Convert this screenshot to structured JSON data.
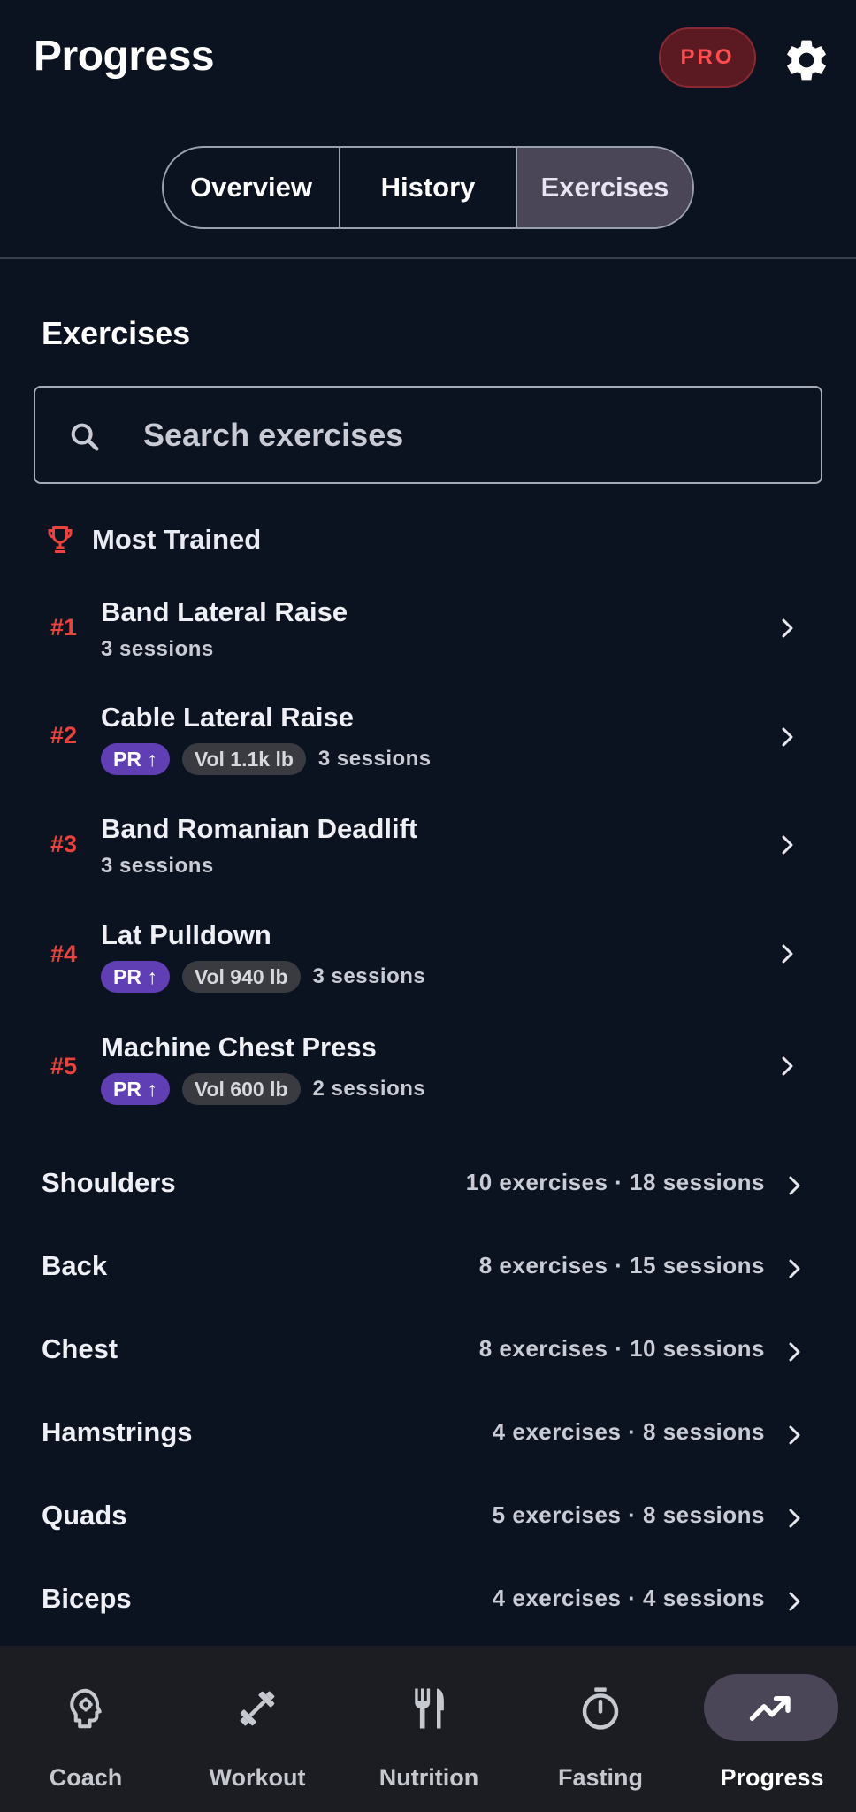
{
  "header": {
    "title": "Progress",
    "pro_label": "PRO"
  },
  "tabs": [
    {
      "label": "Overview",
      "active": false
    },
    {
      "label": "History",
      "active": false
    },
    {
      "label": "Exercises",
      "active": true
    }
  ],
  "section": {
    "title": "Exercises"
  },
  "search": {
    "placeholder": "Search exercises"
  },
  "most_trained": {
    "label": "Most Trained",
    "items": [
      {
        "rank": "#1",
        "name": "Band Lateral Raise",
        "pr": "",
        "vol": "",
        "sessions": "3 sessions"
      },
      {
        "rank": "#2",
        "name": "Cable Lateral Raise",
        "pr": "PR ↑",
        "vol": "Vol 1.1k lb",
        "sessions": "3 sessions"
      },
      {
        "rank": "#3",
        "name": "Band Romanian Deadlift",
        "pr": "",
        "vol": "",
        "sessions": "3 sessions"
      },
      {
        "rank": "#4",
        "name": "Lat Pulldown",
        "pr": "PR ↑",
        "vol": "Vol 940 lb",
        "sessions": "3 sessions"
      },
      {
        "rank": "#5",
        "name": "Machine Chest Press",
        "pr": "PR ↑",
        "vol": "Vol 600 lb",
        "sessions": "2 sessions"
      }
    ]
  },
  "muscle_groups": [
    {
      "name": "Shoulders",
      "meta": "10 exercises · 18 sessions"
    },
    {
      "name": "Back",
      "meta": "8 exercises · 15 sessions"
    },
    {
      "name": "Chest",
      "meta": "8 exercises · 10 sessions"
    },
    {
      "name": "Hamstrings",
      "meta": "4 exercises · 8 sessions"
    },
    {
      "name": "Quads",
      "meta": "5 exercises · 8 sessions"
    },
    {
      "name": "Biceps",
      "meta": "4 exercises · 4 sessions"
    }
  ],
  "nav": [
    {
      "label": "Coach",
      "icon": "brain-icon",
      "active": false
    },
    {
      "label": "Workout",
      "icon": "dumbbell-icon",
      "active": false
    },
    {
      "label": "Nutrition",
      "icon": "fork-knife-icon",
      "active": false
    },
    {
      "label": "Fasting",
      "icon": "stopwatch-icon",
      "active": false
    },
    {
      "label": "Progress",
      "icon": "trending-up-icon",
      "active": true
    }
  ],
  "colors": {
    "background": "#0b1220",
    "accent_red": "#e8433c",
    "pr_purple": "#5f3fb3",
    "active_tab": "#4a4658"
  }
}
